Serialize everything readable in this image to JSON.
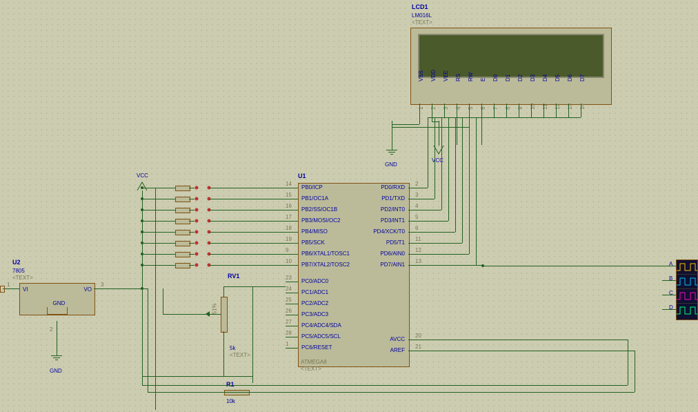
{
  "lcd": {
    "ref": "LCD1",
    "part": "LM016L",
    "textph": "<TEXT>",
    "pins_names": [
      "VSS",
      "VDD",
      "VEE",
      "RS",
      "RW",
      "E",
      "D0",
      "D1",
      "D2",
      "D3",
      "D4",
      "D5",
      "D6",
      "D7"
    ],
    "pins_nums": [
      "1",
      "2",
      "3",
      "4",
      "5",
      "6",
      "7",
      "8",
      "9",
      "10",
      "11",
      "12",
      "13",
      "14"
    ]
  },
  "u1": {
    "ref": "U1",
    "part": "ATMEGA8",
    "textph": "<TEXT>",
    "left_pins": [
      {
        "n": "14",
        "name": "PB0/ICP"
      },
      {
        "n": "15",
        "name": "PB1/OC1A"
      },
      {
        "n": "16",
        "name": "PB2/SS/OC1B"
      },
      {
        "n": "17",
        "name": "PB3/MOSI/OC2"
      },
      {
        "n": "18",
        "name": "PB4/MISO"
      },
      {
        "n": "19",
        "name": "PB5/SCK"
      },
      {
        "n": "9",
        "name": "PB6/XTAL1/TOSC1"
      },
      {
        "n": "10",
        "name": "PB7/XTAL2/TOSC2"
      },
      {
        "n": "23",
        "name": "PC0/ADC0"
      },
      {
        "n": "24",
        "name": "PC1/ADC1"
      },
      {
        "n": "25",
        "name": "PC2/ADC2"
      },
      {
        "n": "26",
        "name": "PC3/ADC3"
      },
      {
        "n": "27",
        "name": "PC4/ADC4/SDA"
      },
      {
        "n": "28",
        "name": "PC5/ADC5/SCL"
      },
      {
        "n": "1",
        "name": "PC6/RESET"
      }
    ],
    "right_pins": [
      {
        "n": "2",
        "name": "PD0/RXD"
      },
      {
        "n": "3",
        "name": "PD1/TXD"
      },
      {
        "n": "4",
        "name": "PD2/INT0"
      },
      {
        "n": "5",
        "name": "PD3/INT1"
      },
      {
        "n": "6",
        "name": "PD4/XCK/T0"
      },
      {
        "n": "11",
        "name": "PD5/T1"
      },
      {
        "n": "12",
        "name": "PD6/AIN0"
      },
      {
        "n": "13",
        "name": "PD7/AIN1"
      },
      {
        "n": "20",
        "name": "AVCC"
      },
      {
        "n": "21",
        "name": "AREF"
      }
    ]
  },
  "u2": {
    "ref": "U2",
    "part": "7805",
    "textph": "<TEXT>",
    "vi": "VI",
    "vo": "VO",
    "gnd": "GND",
    "pin1": "1",
    "pin2": "2",
    "pin3": "3"
  },
  "rv1": {
    "ref": "RV1",
    "value": "5k",
    "textph": "<TEXT>"
  },
  "r1": {
    "ref": "R1",
    "value": "10k"
  },
  "net_gnd": "GND",
  "net_vcc": "VCC",
  "scope_channels": [
    "A",
    "B",
    "C",
    "D"
  ]
}
